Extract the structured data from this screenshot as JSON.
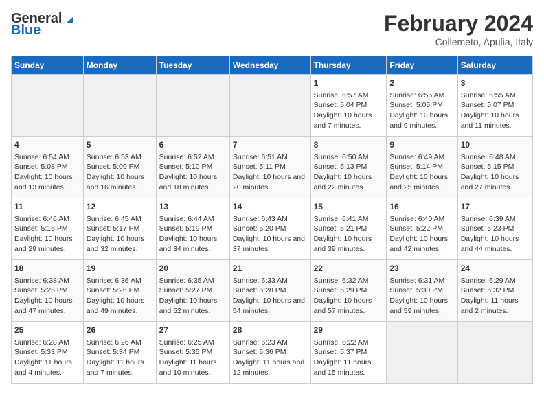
{
  "header": {
    "logo_text_general": "General",
    "logo_text_blue": "Blue",
    "title": "February 2024",
    "subtitle": "Collemeto, Apulia, Italy"
  },
  "weekdays": [
    "Sunday",
    "Monday",
    "Tuesday",
    "Wednesday",
    "Thursday",
    "Friday",
    "Saturday"
  ],
  "weeks": [
    [
      {
        "day": "",
        "empty": true
      },
      {
        "day": "",
        "empty": true
      },
      {
        "day": "",
        "empty": true
      },
      {
        "day": "",
        "empty": true
      },
      {
        "day": "1",
        "sunrise": "6:57 AM",
        "sunset": "5:04 PM",
        "daylight": "10 hours and 7 minutes."
      },
      {
        "day": "2",
        "sunrise": "6:56 AM",
        "sunset": "5:05 PM",
        "daylight": "10 hours and 9 minutes."
      },
      {
        "day": "3",
        "sunrise": "6:55 AM",
        "sunset": "5:07 PM",
        "daylight": "10 hours and 11 minutes."
      }
    ],
    [
      {
        "day": "4",
        "sunrise": "6:54 AM",
        "sunset": "5:08 PM",
        "daylight": "10 hours and 13 minutes."
      },
      {
        "day": "5",
        "sunrise": "6:53 AM",
        "sunset": "5:09 PM",
        "daylight": "10 hours and 16 minutes."
      },
      {
        "day": "6",
        "sunrise": "6:52 AM",
        "sunset": "5:10 PM",
        "daylight": "10 hours and 18 minutes."
      },
      {
        "day": "7",
        "sunrise": "6:51 AM",
        "sunset": "5:11 PM",
        "daylight": "10 hours and 20 minutes."
      },
      {
        "day": "8",
        "sunrise": "6:50 AM",
        "sunset": "5:13 PM",
        "daylight": "10 hours and 22 minutes."
      },
      {
        "day": "9",
        "sunrise": "6:49 AM",
        "sunset": "5:14 PM",
        "daylight": "10 hours and 25 minutes."
      },
      {
        "day": "10",
        "sunrise": "6:48 AM",
        "sunset": "5:15 PM",
        "daylight": "10 hours and 27 minutes."
      }
    ],
    [
      {
        "day": "11",
        "sunrise": "6:46 AM",
        "sunset": "5:16 PM",
        "daylight": "10 hours and 29 minutes."
      },
      {
        "day": "12",
        "sunrise": "6:45 AM",
        "sunset": "5:17 PM",
        "daylight": "10 hours and 32 minutes."
      },
      {
        "day": "13",
        "sunrise": "6:44 AM",
        "sunset": "5:19 PM",
        "daylight": "10 hours and 34 minutes."
      },
      {
        "day": "14",
        "sunrise": "6:43 AM",
        "sunset": "5:20 PM",
        "daylight": "10 hours and 37 minutes."
      },
      {
        "day": "15",
        "sunrise": "6:41 AM",
        "sunset": "5:21 PM",
        "daylight": "10 hours and 39 minutes."
      },
      {
        "day": "16",
        "sunrise": "6:40 AM",
        "sunset": "5:22 PM",
        "daylight": "10 hours and 42 minutes."
      },
      {
        "day": "17",
        "sunrise": "6:39 AM",
        "sunset": "5:23 PM",
        "daylight": "10 hours and 44 minutes."
      }
    ],
    [
      {
        "day": "18",
        "sunrise": "6:38 AM",
        "sunset": "5:25 PM",
        "daylight": "10 hours and 47 minutes."
      },
      {
        "day": "19",
        "sunrise": "6:36 AM",
        "sunset": "5:26 PM",
        "daylight": "10 hours and 49 minutes."
      },
      {
        "day": "20",
        "sunrise": "6:35 AM",
        "sunset": "5:27 PM",
        "daylight": "10 hours and 52 minutes."
      },
      {
        "day": "21",
        "sunrise": "6:33 AM",
        "sunset": "5:28 PM",
        "daylight": "10 hours and 54 minutes."
      },
      {
        "day": "22",
        "sunrise": "6:32 AM",
        "sunset": "5:29 PM",
        "daylight": "10 hours and 57 minutes."
      },
      {
        "day": "23",
        "sunrise": "6:31 AM",
        "sunset": "5:30 PM",
        "daylight": "10 hours and 59 minutes."
      },
      {
        "day": "24",
        "sunrise": "6:29 AM",
        "sunset": "5:32 PM",
        "daylight": "11 hours and 2 minutes."
      }
    ],
    [
      {
        "day": "25",
        "sunrise": "6:28 AM",
        "sunset": "5:33 PM",
        "daylight": "11 hours and 4 minutes."
      },
      {
        "day": "26",
        "sunrise": "6:26 AM",
        "sunset": "5:34 PM",
        "daylight": "11 hours and 7 minutes."
      },
      {
        "day": "27",
        "sunrise": "6:25 AM",
        "sunset": "5:35 PM",
        "daylight": "11 hours and 10 minutes."
      },
      {
        "day": "28",
        "sunrise": "6:23 AM",
        "sunset": "5:36 PM",
        "daylight": "11 hours and 12 minutes."
      },
      {
        "day": "29",
        "sunrise": "6:22 AM",
        "sunset": "5:37 PM",
        "daylight": "11 hours and 15 minutes."
      },
      {
        "day": "",
        "empty": true
      },
      {
        "day": "",
        "empty": true
      }
    ]
  ]
}
